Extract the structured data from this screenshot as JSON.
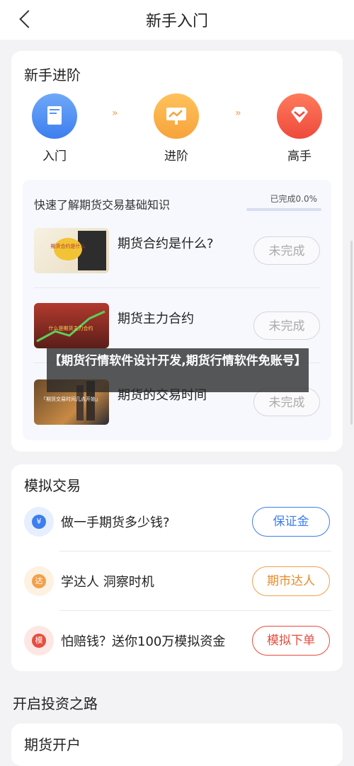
{
  "header": {
    "title": "新手入门"
  },
  "beginner": {
    "title": "新手进阶",
    "steps": [
      {
        "label": "入门",
        "icon": "book-icon"
      },
      {
        "label": "进阶",
        "icon": "chart-board-icon"
      },
      {
        "label": "高手",
        "icon": "diamond-icon"
      }
    ],
    "quick_learn": "快速了解期货交易基础知识",
    "progress_text": "已完成0.0%",
    "progress": 0.0,
    "lessons": [
      {
        "name": "期货合约是什么?",
        "status": "未完成",
        "thumb_text": "期货合约是什么"
      },
      {
        "name": "期货主力合约",
        "status": "未完成",
        "thumb_text": "什么是期货主力合约"
      },
      {
        "name": "期货的交易时间",
        "status": "未完成",
        "thumb_text": "「期货交易时间几点开始」"
      }
    ]
  },
  "overlay": {
    "text": "【期货行情软件设计开发,期货行情软件免账号】"
  },
  "simulation": {
    "title": "模拟交易",
    "rows": [
      {
        "icon_char": "¥",
        "text": "做一手期货多少钱?",
        "button": "保证金"
      },
      {
        "icon_char": "达",
        "text": "学达人 洞察时机",
        "button": "期市达人"
      },
      {
        "icon_char": "模",
        "text": "怕赔钱？送你100万模拟资金",
        "button": "模拟下单"
      }
    ]
  },
  "invest": {
    "title": "开启投资之路",
    "next_card": "期货开户"
  },
  "colors": {
    "accent_blue": "#3d7ef0",
    "accent_orange": "#f1a04a",
    "accent_red": "#e74c3c"
  }
}
